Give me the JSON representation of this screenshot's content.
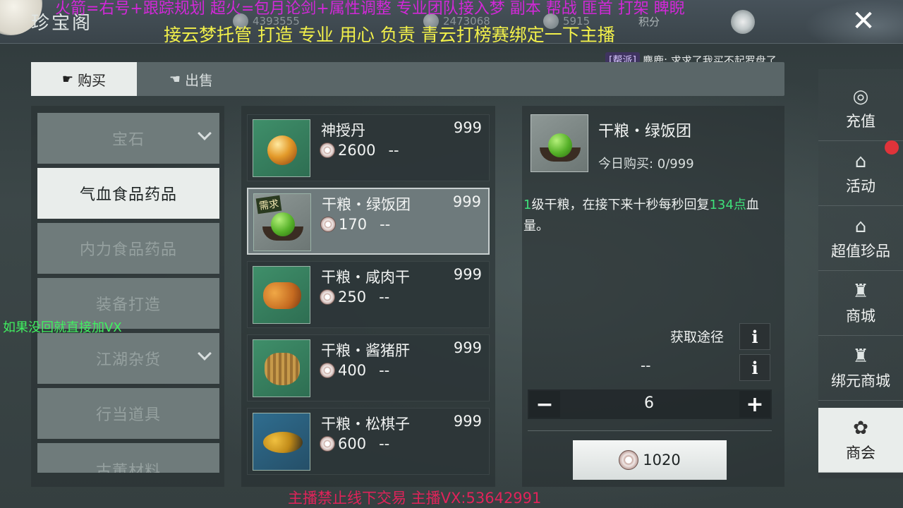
{
  "header": {
    "title": "珍宝阁",
    "currency1": "4393555",
    "currency2": "2473068",
    "currency3": "5915",
    "score_label": "积分",
    "close_glyph": "✕"
  },
  "overlays": {
    "top_line1": "火箭=右号+跟踪规划 超火=包月论剑+属性调整 专业团队接入梦 副本 帮战 匪首 打架 睥睨",
    "top_line2": "接云梦托管 打造 专业 用心 负责  青云打榜赛绑定一下主播",
    "left_note": "如果没回就直接加VX",
    "bottom_note": "主播禁止线下交易    主播VX:53642991"
  },
  "chat": {
    "tag": "[帮派]",
    "message": "麋鹿: 求求了我买不起罗盘了"
  },
  "tabs": {
    "buy": "购买",
    "sell": "出售"
  },
  "categories": [
    {
      "label": "宝石",
      "active": false,
      "has_chevron": true
    },
    {
      "label": "气血食品药品",
      "active": true,
      "has_chevron": false
    },
    {
      "label": "内力食品药品",
      "active": false,
      "has_chevron": false
    },
    {
      "label": "装备打造",
      "active": false,
      "has_chevron": false
    },
    {
      "label": "江湖杂货",
      "active": false,
      "has_chevron": true
    },
    {
      "label": "行当道具",
      "active": false,
      "has_chevron": false
    },
    {
      "label": "古董材料",
      "active": false,
      "has_chevron": false
    }
  ],
  "items": [
    {
      "name": "神授丹",
      "qty": "999",
      "price": "2600",
      "limit": "--",
      "selected": false
    },
    {
      "name": "干粮・绿饭团",
      "qty": "999",
      "price": "170",
      "limit": "--",
      "selected": true,
      "badge": "需求"
    },
    {
      "name": "干粮・咸肉干",
      "qty": "999",
      "price": "250",
      "limit": "--",
      "selected": false
    },
    {
      "name": "干粮・酱猪肝",
      "qty": "999",
      "price": "400",
      "limit": "--",
      "selected": false
    },
    {
      "name": "干粮・松棋子",
      "qty": "999",
      "price": "600",
      "limit": "--",
      "selected": false
    }
  ],
  "detail": {
    "name": "干粮・绿饭团",
    "today_label": "今日购买: 0/999",
    "desc_level": "1",
    "desc_part1": "级干粮，在接下来十秒每秒回复",
    "desc_amount": "134",
    "desc_unit": "点",
    "desc_part2": "血量。",
    "source_label": "获取途径",
    "source_value": "--",
    "info_glyph": "i",
    "minus_glyph": "−",
    "plus_glyph": "+",
    "quantity": "6",
    "total_price": "1020"
  },
  "side_nav": [
    {
      "label": "充值",
      "icon": "money-bag-icon",
      "glyph": "◎",
      "active": false
    },
    {
      "label": "活动",
      "icon": "pavilion-icon",
      "glyph": "⌂",
      "active": false,
      "badge_dot": true
    },
    {
      "label": "超值珍品",
      "icon": "pavilion-icon",
      "glyph": "⌂",
      "active": false
    },
    {
      "label": "商城",
      "icon": "pagoda-icon",
      "glyph": "♜",
      "active": false
    },
    {
      "label": "绑元商城",
      "icon": "pagoda-icon",
      "glyph": "♜",
      "active": false
    },
    {
      "label": "商会",
      "icon": "guild-emblem-icon",
      "glyph": "✿",
      "active": true
    }
  ],
  "colors": {
    "highlight_green": "#3ee07a",
    "badge_red": "#e0333a",
    "overlay_magenta": "#d228d8",
    "overlay_yellow": "#f2f04a",
    "overlay_green": "#40f060",
    "overlay_red": "#e0235a"
  }
}
